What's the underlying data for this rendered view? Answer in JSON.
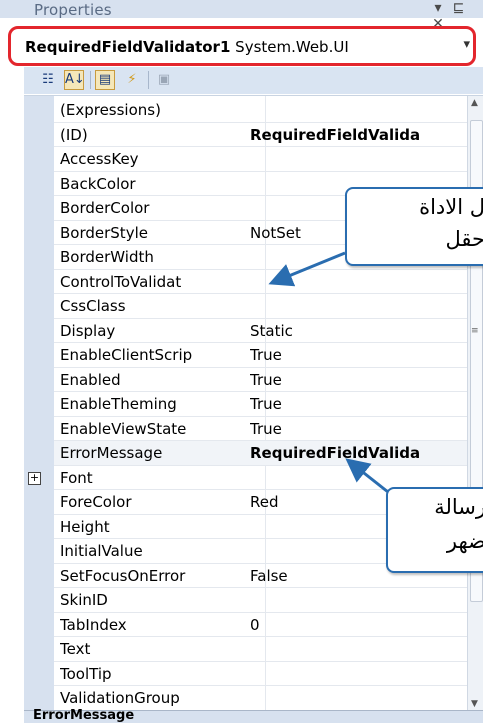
{
  "panel": {
    "title": "Properties",
    "pin_glyph": "▾",
    "autohide_glyph": "⊑",
    "close_glyph": "✕"
  },
  "object_selector": {
    "name": "RequiredFieldValidator1",
    "type": " System.Web.UI",
    "arrow": "▾",
    "highlight_color": "#e3262d"
  },
  "toolbar": {
    "categorized_icon": "☷",
    "alphabetical_icon": "A↓",
    "properties_icon": "▤",
    "events_icon": "⚡",
    "property_pages_icon": "▣"
  },
  "properties": [
    {
      "name": "(Expressions)",
      "value": ""
    },
    {
      "name": "(ID)",
      "value": "RequiredFieldValida",
      "bold": true
    },
    {
      "name": "AccessKey",
      "value": ""
    },
    {
      "name": "BackColor",
      "value": ""
    },
    {
      "name": "BorderColor",
      "value": ""
    },
    {
      "name": "BorderStyle",
      "value": "NotSet"
    },
    {
      "name": "BorderWidth",
      "value": ""
    },
    {
      "name": "ControlToValidat",
      "value": ""
    },
    {
      "name": "CssClass",
      "value": ""
    },
    {
      "name": "Display",
      "value": "Static"
    },
    {
      "name": "EnableClientScrip",
      "value": "True"
    },
    {
      "name": "Enabled",
      "value": "True"
    },
    {
      "name": "EnableTheming",
      "value": "True"
    },
    {
      "name": "EnableViewState",
      "value": "True"
    },
    {
      "name": "ErrorMessage",
      "value": "RequiredFieldValida",
      "bold": true,
      "selected": true
    },
    {
      "name": "Font",
      "value": "",
      "expandable": true,
      "expand_glyph": "+"
    },
    {
      "name": "ForeColor",
      "value": "Red"
    },
    {
      "name": "Height",
      "value": ""
    },
    {
      "name": "InitialValue",
      "value": ""
    },
    {
      "name": "SetFocusOnError",
      "value": "False"
    },
    {
      "name": "SkinID",
      "value": ""
    },
    {
      "name": "TabIndex",
      "value": "0"
    },
    {
      "name": "Text",
      "value": ""
    },
    {
      "name": "ToolTip",
      "value": ""
    },
    {
      "name": "ValidationGroup",
      "value": ""
    }
  ],
  "scrollbar": {
    "up": "▲",
    "down": "▼",
    "grip": "≡"
  },
  "footer": {
    "label": "ErrorMessage"
  },
  "callouts": [
    {
      "line1": "ل الاداة",
      "line2": "حقل"
    },
    {
      "line1": "رسالة",
      "line2": "ضهر"
    }
  ],
  "annotation_color": "#2a6db0"
}
